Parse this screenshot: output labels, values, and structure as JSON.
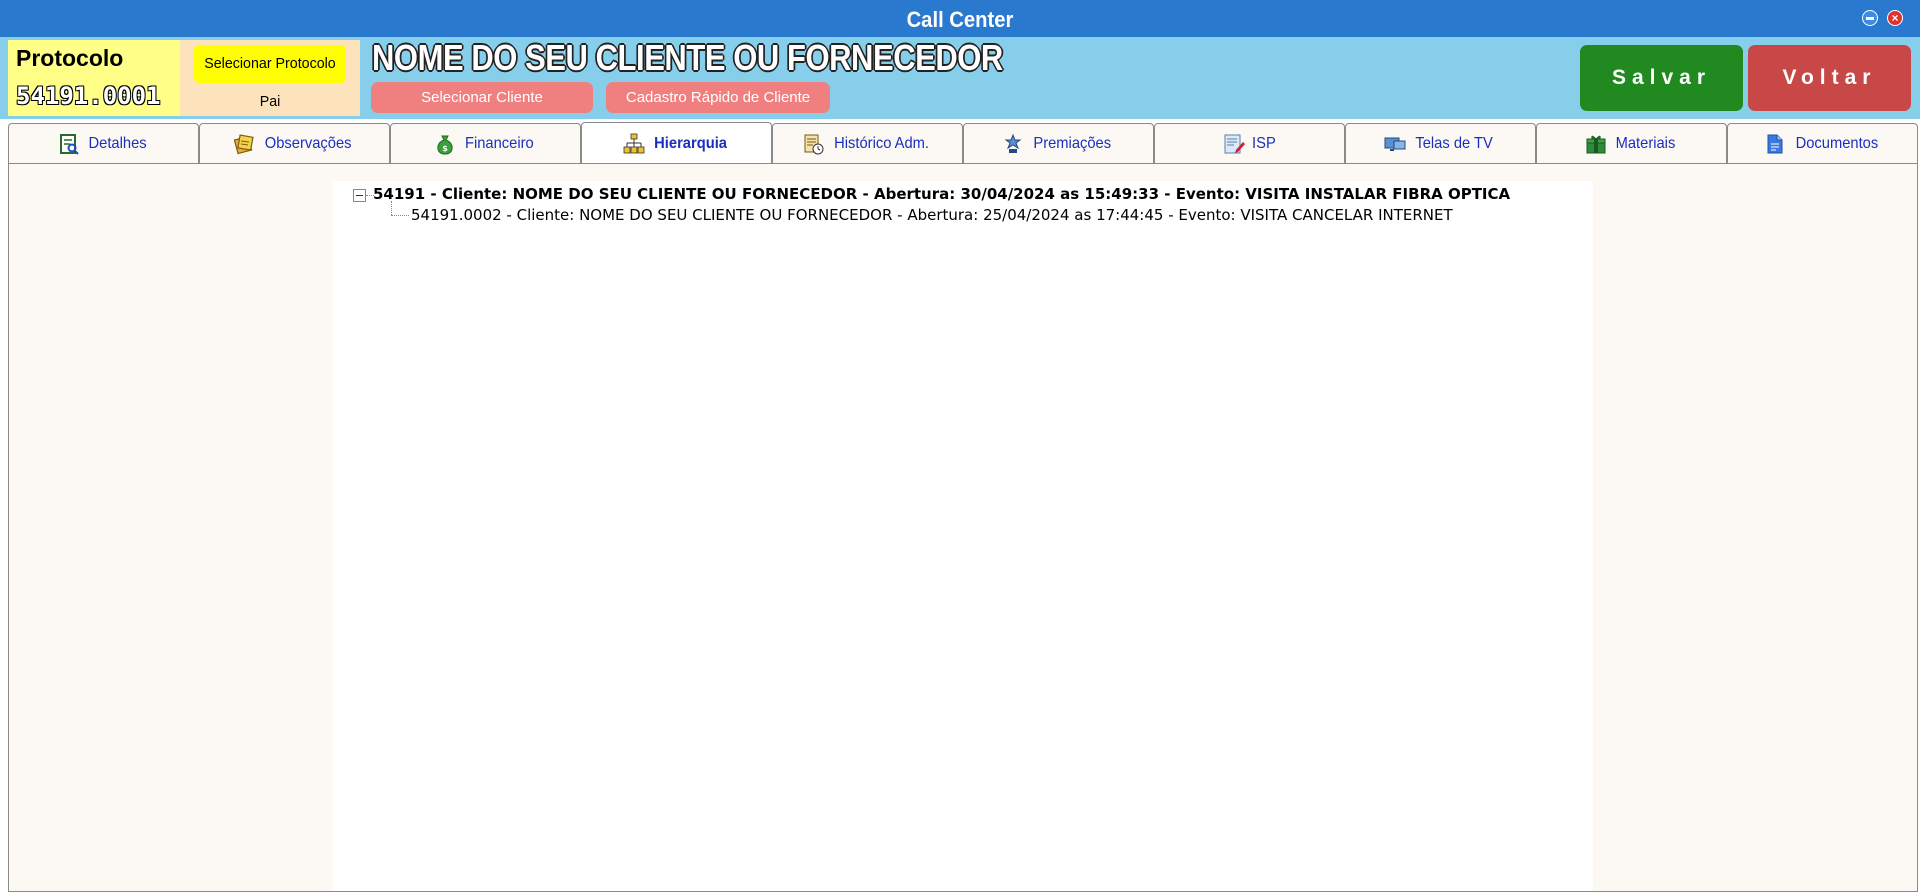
{
  "window": {
    "title": "Call Center"
  },
  "header": {
    "protocol_label": "Protocolo",
    "protocol_number": "54191.0001",
    "select_parent_label": "Selecionar Protocolo Pai",
    "client_name": "NOME DO SEU CLIENTE OU FORNECEDOR",
    "select_client_label": "Selecionar Cliente",
    "quick_register_label": "Cadastro Rápido de Cliente",
    "save_label": "Salvar",
    "back_label": "Voltar"
  },
  "tabs": [
    {
      "label": "Detalhes",
      "icon": "details-icon",
      "active": false
    },
    {
      "label": "Observações",
      "icon": "notes-icon",
      "active": false
    },
    {
      "label": "Financeiro",
      "icon": "money-bag-icon",
      "active": false
    },
    {
      "label": "Hierarquia",
      "icon": "hierarchy-icon",
      "active": true
    },
    {
      "label": "Histórico Adm.",
      "icon": "history-icon",
      "active": false
    },
    {
      "label": "Premiações",
      "icon": "award-icon",
      "active": false
    },
    {
      "label": "ISP",
      "icon": "isp-icon",
      "active": false
    },
    {
      "label": "Telas de TV",
      "icon": "tv-screens-icon",
      "active": false
    },
    {
      "label": "Materiais",
      "icon": "materials-icon",
      "active": false
    },
    {
      "label": "Documentos",
      "icon": "documents-icon",
      "active": false
    }
  ],
  "tree": {
    "root": "54191 - Cliente: NOME DO SEU CLIENTE OU FORNECEDOR - Abertura: 30/04/2024 as 15:49:33 - Evento: VISITA INSTALAR FIBRA OPTICA",
    "children": [
      "54191.0002 - Cliente: NOME DO SEU CLIENTE OU FORNECEDOR - Abertura: 25/04/2024 as 17:44:45 - Evento: VISITA CANCELAR INTERNET"
    ]
  },
  "colors": {
    "titlebar": "#2979cf",
    "header_bg": "#87ceeb",
    "protocol_bg": "#ffff88",
    "save_button": "#208a20",
    "back_button": "#c84848",
    "tab_text": "#1a2fbf"
  }
}
